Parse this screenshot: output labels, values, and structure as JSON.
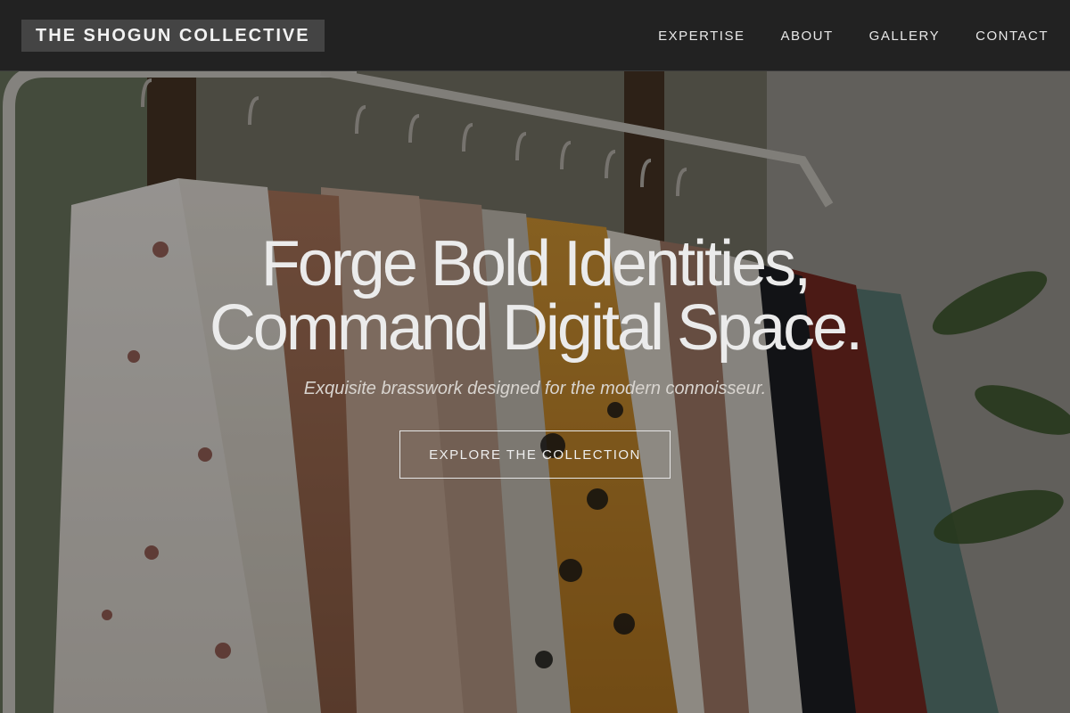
{
  "header": {
    "logo_text": "THE SHOGUN COLLECTIVE",
    "nav": [
      {
        "label": "EXPERTISE"
      },
      {
        "label": "ABOUT"
      },
      {
        "label": "GALLERY"
      },
      {
        "label": "CONTACT"
      }
    ]
  },
  "hero": {
    "title_line1": "Forge Bold Identities,",
    "title_line2": "Command Digital Space.",
    "subtitle": "Exquisite brasswork designed for the modern connoisseur.",
    "cta_label": "EXPLORE THE COLLECTION",
    "background_image": "clothing-rack-photo"
  },
  "colors": {
    "header_bg": "#222222",
    "logo_bg": "#444444",
    "text_light": "#ebebeb"
  }
}
